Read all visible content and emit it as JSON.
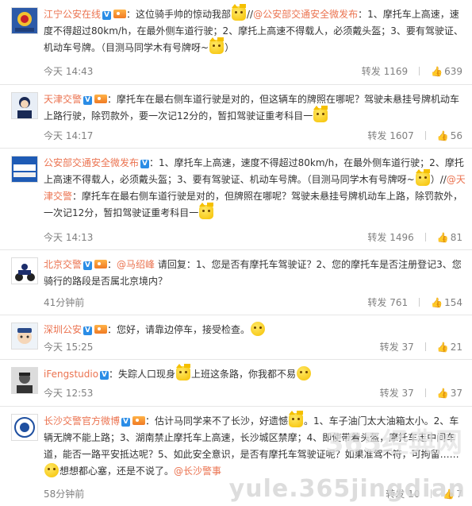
{
  "posts": [
    {
      "author": "江宁公安在线",
      "verified": "V",
      "text_parts": [
        "：这位骑手帅的惊动我部",
        "//",
        "@公安部交通安全微发布",
        "：1、摩托车上高速，速度不得超过80km/h，在最外侧车道行驶；2、摩托上高速不得载人，必须戴头盔；3、要有驾驶证、机动车号牌。（目测马同学木有号牌呀~",
        "）"
      ],
      "time": "今天 14:43",
      "repost_label": "转发",
      "reposts": "1169",
      "likes": "639"
    },
    {
      "author": "天津交警",
      "verified": "V",
      "text": "：摩托车在最右侧车道行驶是对的，但这辆车的牌照在哪呢？驾驶未悬挂号牌机动车上路行驶，除罚款外，要一次记12分的，暂扣驾驶证重考科目一",
      "time": "今天 14:17",
      "repost_label": "转发",
      "reposts": "1607",
      "likes": "56"
    },
    {
      "author": "公安部交通安全微发布",
      "verified": "V",
      "text": "：1、摩托车上高速，速度不得超过80km/h，在最外侧车道行驶；2、摩托上高速不得载人，必须戴头盔；3、要有驾驶证、机动车号牌。（目测马同学木有号牌呀~",
      "text_tail": "）//",
      "quote_author": "@天津交警",
      "quote_text": "：摩托车在最右侧车道行驶是对的，但牌照在哪呢？驾驶未悬挂号牌机动车上路，除罚款外，一次记12分，暂扣驾驶证重考科目一",
      "time": "今天 14:13",
      "repost_label": "转发",
      "reposts": "1496",
      "likes": "81"
    },
    {
      "author": "北京交警",
      "verified": "V",
      "reply_to": "@马绍峰",
      "text": "请回复：1、您是否有摩托车驾驶证？2、您的摩托车是否注册登记3、您骑行的路段是否属北京境内？",
      "time": "41分钟前",
      "repost_label": "转发",
      "reposts": "761",
      "likes": "154"
    },
    {
      "author": "深圳公安",
      "verified": "V",
      "text": "：您好，请靠边停车，接受检查。",
      "time": "今天 15:25",
      "repost_label": "转发",
      "reposts": "37",
      "likes": "21"
    },
    {
      "author": "iFengstudio",
      "verified": "V",
      "text": "：失踪人口现身",
      "text_mid": "上班这条路，你我都不易",
      "time": "今天 12:53",
      "repost_label": "转发",
      "reposts": "37",
      "likes": "37"
    },
    {
      "author": "长沙交警官方微博",
      "verified": "V",
      "text": "：估计马同学来不了长沙，好遗憾",
      "text2": "。1、车子油门太大油箱太小。2、车辆无牌不能上路；3、湖南禁止摩托车上高速，长沙城区禁摩；4、即使带着头盔，摩托车走中间车道，能否一路平安抵达呢？5、如此安全意识，是否有摩托车驾驶证呢？如果准驾不符，可拘留……",
      "text3": "想想都心塞，还是不说了。",
      "mention_end": "@长沙警事",
      "time": "58分钟前",
      "repost_label": "转发",
      "reposts": "10",
      "likes": "7"
    }
  ],
  "watermark": "yule.365jingdian",
  "watermark_cn": "365经典网",
  "colors": {
    "name": "#eb7350",
    "meta": "#808080",
    "verified": "#2b8de6"
  }
}
